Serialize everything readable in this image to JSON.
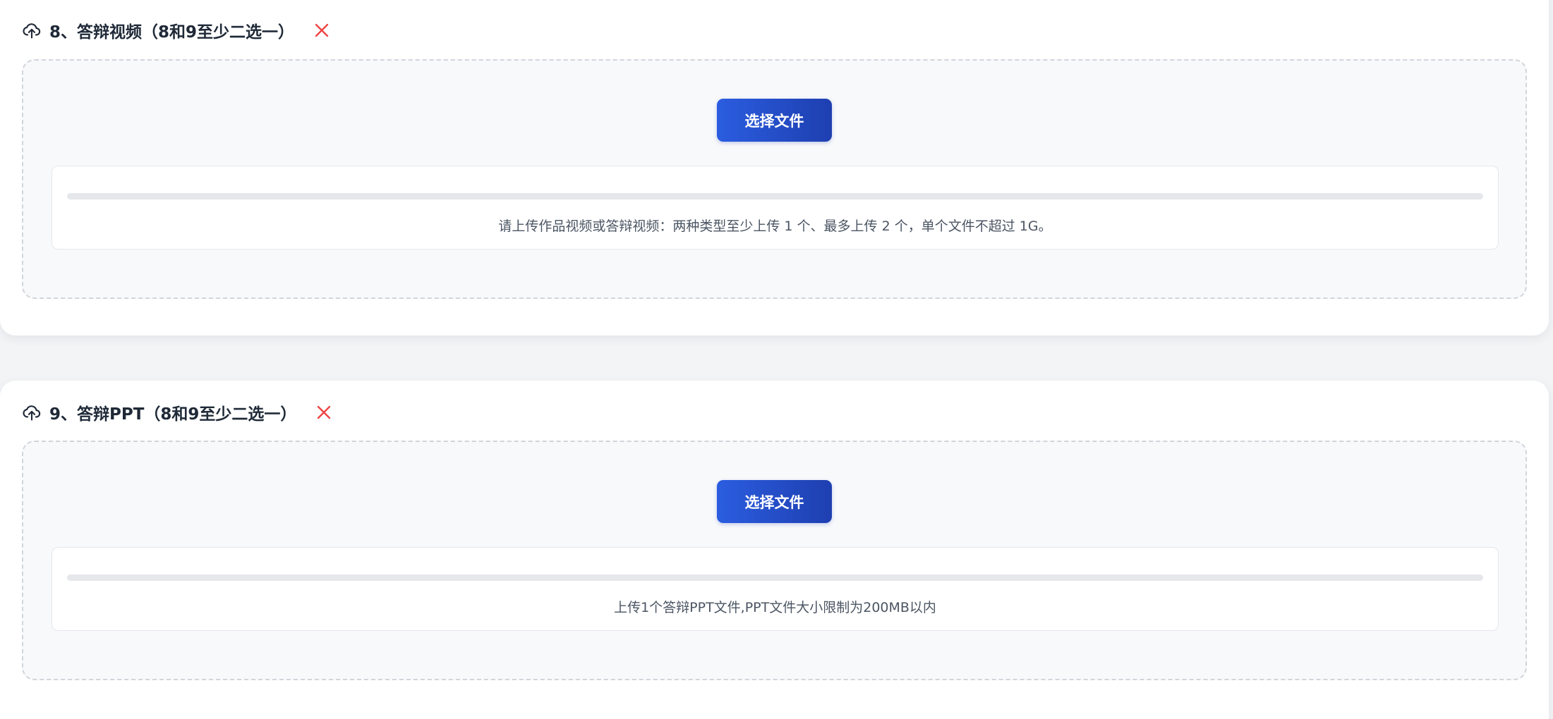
{
  "sections": [
    {
      "title": "8、答辩视频（8和9至少二选一）",
      "icons": {
        "upload": "cloud-upload-icon",
        "remove": "close-icon"
      },
      "choose_button_label": "选择文件",
      "progress": 0,
      "hint": "请上传作品视频或答辩视频：两种类型至少上传 1 个、最多上传 2 个，单个文件不超过 1G。"
    },
    {
      "title": "9、答辩PPT（8和9至少二选一）",
      "icons": {
        "upload": "cloud-upload-icon",
        "remove": "close-icon"
      },
      "choose_button_label": "选择文件",
      "progress": 0,
      "hint": "上传1个答辩PPT文件,PPT文件大小限制为200MB以内"
    }
  ],
  "colors": {
    "accent": "#2b5de0",
    "accent_dark": "#1e3fb0",
    "remove": "#ef4444",
    "title": "#1f2937",
    "hint": "#4b5563"
  }
}
